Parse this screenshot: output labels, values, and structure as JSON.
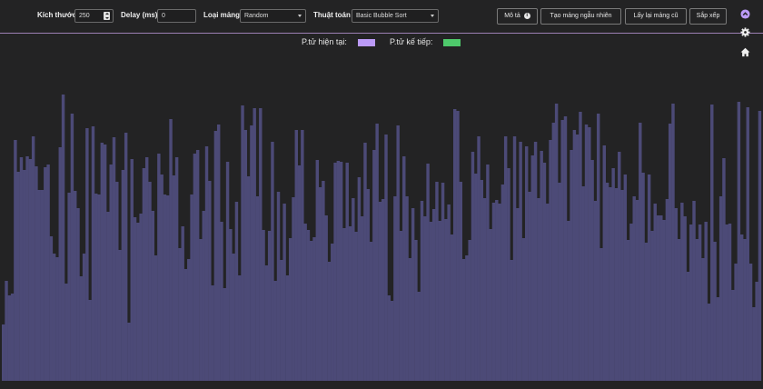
{
  "toolbar": {
    "size_label": "Kích thước",
    "size_value": "250",
    "delay_label": "Delay (ms)",
    "delay_value": "0",
    "array_type_label": "Loại mảng",
    "array_type_value": "Random",
    "algorithm_label": "Thuật toán",
    "algorithm_value": "Basic Bubble Sort",
    "describe_button": "Mô tả",
    "random_array_button": "Tạo mảng ngẫu nhiên",
    "old_array_button": "Lấy lại mảng cũ",
    "sort_button": "Sắp xếp"
  },
  "sidebar": {
    "icons": [
      "chevron-up-circle-icon",
      "gear-icon",
      "home-icon"
    ]
  },
  "legend": {
    "current_label": "P.tử hiện tại:",
    "next_label": "P.tử kế tiếp:",
    "current_color": "#bb9af7",
    "next_color": "#4ec96b"
  },
  "colors": {
    "background": "#232324",
    "bar": "#4c4a77",
    "toolbar_border": "#9c7fb3"
  },
  "bars": [
    62,
    110,
    94,
    96,
    265,
    230,
    246,
    232,
    247,
    244,
    269,
    236,
    210,
    210,
    235,
    238,
    159,
    140,
    136,
    257,
    315,
    107,
    207,
    294,
    209,
    190,
    115,
    140,
    278,
    89,
    280,
    206,
    205,
    262,
    260,
    186,
    238,
    268,
    219,
    144,
    232,
    273,
    64,
    244,
    180,
    174,
    184,
    234,
    246,
    219,
    187,
    138,
    250,
    227,
    205,
    204,
    288,
    226,
    246,
    146,
    170,
    123,
    134,
    205,
    250,
    254,
    156,
    187,
    258,
    220,
    105,
    275,
    282,
    175,
    102,
    241,
    167,
    140,
    197,
    116,
    303,
    276,
    225,
    281,
    300,
    203,
    300,
    166,
    127,
    165,
    263,
    110,
    208,
    133,
    195,
    116,
    157,
    202,
    276,
    237,
    276,
    173,
    166,
    154,
    158,
    243,
    213,
    220,
    182,
    131,
    151,
    240,
    242,
    241,
    168,
    240,
    170,
    201,
    164,
    224,
    181,
    262,
    211,
    153,
    254,
    283,
    197,
    200,
    271,
    94,
    88,
    203,
    281,
    165,
    247,
    203,
    135,
    190,
    155,
    98,
    198,
    181,
    239,
    175,
    189,
    219,
    176,
    218,
    178,
    194,
    161,
    299,
    297,
    219,
    134,
    138,
    155,
    252,
    228,
    269,
    221,
    201,
    238,
    167,
    196,
    199,
    195,
    216,
    269,
    234,
    133,
    269,
    190,
    263,
    157,
    258,
    208,
    248,
    263,
    201,
    253,
    240,
    195,
    265,
    284,
    305,
    218,
    287,
    291,
    176,
    254,
    276,
    271,
    296,
    214,
    282,
    279,
    243,
    198,
    294,
    146,
    259,
    218,
    213,
    234,
    212,
    252,
    210,
    227,
    155,
    173,
    203,
    199,
    284,
    229,
    152,
    227,
    165,
    195,
    182,
    182,
    177,
    200,
    283,
    305,
    190,
    156,
    196,
    181,
    120,
    172,
    198,
    156,
    172,
    135,
    175,
    85,
    304,
    153,
    92,
    203,
    245,
    172,
    173,
    100,
    129,
    307,
    161,
    156,
    301,
    129,
    81,
    109,
    297
  ]
}
